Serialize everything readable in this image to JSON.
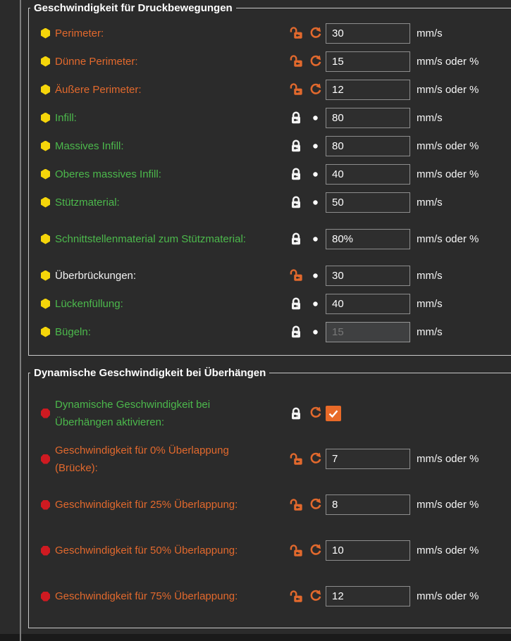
{
  "app": {
    "context": "slicer-print-settings-speed-page",
    "units": {
      "speed": "mm/s",
      "speed_or_percent": "mm/s oder %"
    }
  },
  "colors": {
    "background": "#2b2b2b",
    "accent_orange": "#e2692d",
    "modified_green": "#4cb94c",
    "label_white": "#f2f2f2",
    "bullet_yellow": "#f5d50a",
    "bullet_red": "#cf1a21",
    "groupbox_border": "#c9c9c9",
    "checkbox_orange": "#e86a28"
  },
  "groups": [
    {
      "title": "Geschwindigkeit für Druckbewegungen",
      "rows": [
        {
          "label": "Perimeter:",
          "bullet": "yellow",
          "label_style": "orange",
          "lock": "unlocked",
          "revert": "arrow",
          "control": "input",
          "value": "30",
          "unit": "mm/s",
          "disabled": false,
          "lines": 1
        },
        {
          "label": "Dünne Perimeter:",
          "bullet": "yellow",
          "label_style": "orange",
          "lock": "unlocked",
          "revert": "arrow",
          "control": "input",
          "value": "15",
          "unit": "mm/s oder %",
          "disabled": false,
          "lines": 1
        },
        {
          "label": "Äußere Perimeter:",
          "bullet": "yellow",
          "label_style": "orange",
          "lock": "unlocked",
          "revert": "arrow",
          "control": "input",
          "value": "12",
          "unit": "mm/s oder %",
          "disabled": false,
          "lines": 1
        },
        {
          "label": "Infill:",
          "bullet": "yellow",
          "label_style": "green",
          "lock": "locked",
          "revert": "dot",
          "control": "input",
          "value": "80",
          "unit": "mm/s",
          "disabled": false,
          "lines": 1
        },
        {
          "label": "Massives Infill:",
          "bullet": "yellow",
          "label_style": "green",
          "lock": "locked",
          "revert": "dot",
          "control": "input",
          "value": "80",
          "unit": "mm/s oder %",
          "disabled": false,
          "lines": 1
        },
        {
          "label": "Oberes massives Infill:",
          "bullet": "yellow",
          "label_style": "green",
          "lock": "locked",
          "revert": "dot",
          "control": "input",
          "value": "40",
          "unit": "mm/s oder %",
          "disabled": false,
          "lines": 1
        },
        {
          "label": "Stützmaterial:",
          "bullet": "yellow",
          "label_style": "green",
          "lock": "locked",
          "revert": "dot",
          "control": "input",
          "value": "50",
          "unit": "mm/s",
          "disabled": false,
          "lines": 1
        },
        {
          "label": "Schnittstellenmaterial zum Stützmaterial:",
          "bullet": "yellow",
          "label_style": "green",
          "lock": "locked",
          "revert": "dot",
          "control": "input",
          "value": "80%",
          "unit": "mm/s oder %",
          "disabled": false,
          "lines": 2
        },
        {
          "label": "Überbrückungen:",
          "bullet": "yellow",
          "label_style": "white",
          "lock": "unlocked",
          "revert": "dot",
          "control": "input",
          "value": "30",
          "unit": "mm/s",
          "disabled": false,
          "lines": 1
        },
        {
          "label": "Lückenfüllung:",
          "bullet": "yellow",
          "label_style": "green",
          "lock": "locked",
          "revert": "dot",
          "control": "input",
          "value": "40",
          "unit": "mm/s",
          "disabled": false,
          "lines": 1
        },
        {
          "label": "Bügeln:",
          "bullet": "yellow",
          "label_style": "green",
          "lock": "locked",
          "revert": "dot",
          "control": "input",
          "value": "15",
          "unit": "mm/s",
          "disabled": true,
          "lines": 1
        }
      ]
    },
    {
      "title": "Dynamische Geschwindigkeit bei Überhängen",
      "rows": [
        {
          "label": "Dynamische Geschwindigkeit bei Überhängen aktivieren:",
          "bullet": "red",
          "label_style": "green",
          "lock": "locked",
          "revert": "arrow",
          "control": "checkbox",
          "checked": true,
          "lines": 2
        },
        {
          "label": "Geschwindigkeit für 0% Überlappung (Brücke):",
          "bullet": "red",
          "label_style": "orange",
          "lock": "unlocked",
          "revert": "arrow",
          "control": "input",
          "value": "7",
          "unit": "mm/s oder %",
          "disabled": false,
          "lines": 2
        },
        {
          "label": "Geschwindigkeit für 25% Überlappung:",
          "bullet": "red",
          "label_style": "orange",
          "lock": "unlocked",
          "revert": "arrow",
          "control": "input",
          "value": "8",
          "unit": "mm/s oder %",
          "disabled": false,
          "lines": 2
        },
        {
          "label": "Geschwindigkeit für 50% Überlappung:",
          "bullet": "red",
          "label_style": "orange",
          "lock": "unlocked",
          "revert": "arrow",
          "control": "input",
          "value": "10",
          "unit": "mm/s oder %",
          "disabled": false,
          "lines": 2
        },
        {
          "label": "Geschwindigkeit für 75% Überlappung:",
          "bullet": "red",
          "label_style": "orange",
          "lock": "unlocked",
          "revert": "arrow",
          "control": "input",
          "value": "12",
          "unit": "mm/s oder %",
          "disabled": false,
          "lines": 2
        }
      ]
    }
  ]
}
